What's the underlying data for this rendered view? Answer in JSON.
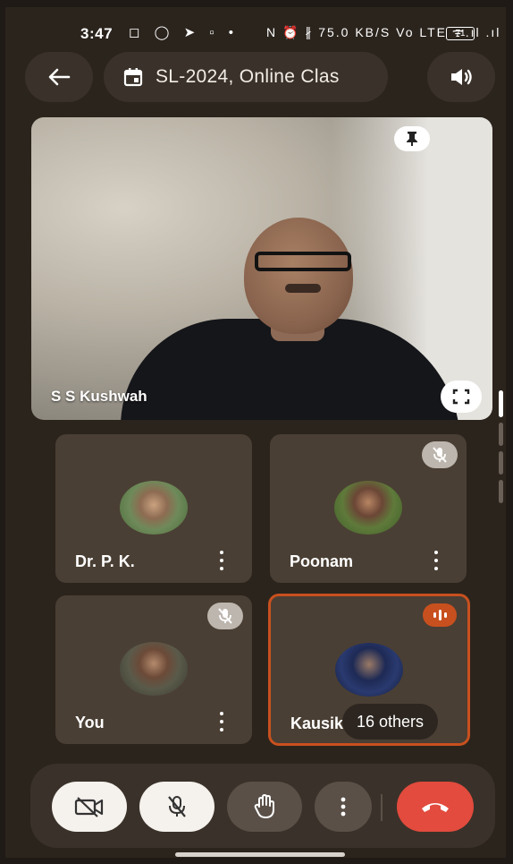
{
  "status_bar": {
    "time": "3:47",
    "icons_left": "◻ ◯ ➤ ▫ •",
    "icons_right": "N ⏰ ∦ 75.0 KB/S  Vo LTE  ᯤ.ıl .ıl",
    "battery": "71"
  },
  "header": {
    "back_icon": "arrow-left-icon",
    "meeting_title": "SL-2024, Online Clas",
    "speaker_icon": "speaker-icon"
  },
  "main_participant": {
    "name": "S S Kushwah",
    "pin_icon": "pin-icon",
    "fullscreen_icon": "fullscreen-icon"
  },
  "participants": [
    {
      "name": "Dr. P. K.",
      "muted": false,
      "speaking": false
    },
    {
      "name": "Poonam",
      "muted": true,
      "speaking": false
    },
    {
      "name": "You",
      "muted": true,
      "speaking": false
    },
    {
      "name": "Kausik",
      "muted": false,
      "speaking": true,
      "others_label": "16 others"
    }
  ],
  "controls": [
    {
      "name": "camera-off",
      "icon": "video-off-icon"
    },
    {
      "name": "mic-off",
      "icon": "mic-off-icon"
    },
    {
      "name": "raise-hand",
      "icon": "hand-icon"
    },
    {
      "name": "more-options",
      "icon": "more-vertical-icon"
    },
    {
      "name": "end-call",
      "icon": "phone-hangup-icon"
    }
  ],
  "colors": {
    "background": "#2b241d",
    "tile": "#4a3f34",
    "active_border": "#c8501e",
    "end_call": "#e24b3d"
  }
}
